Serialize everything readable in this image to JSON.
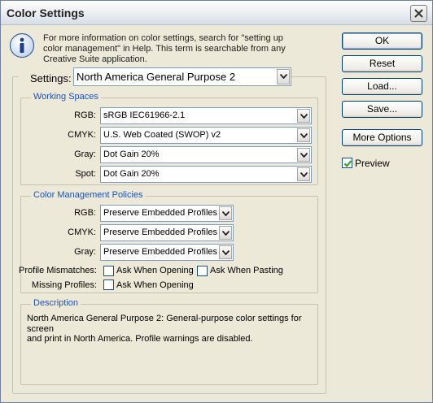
{
  "window": {
    "title": "Color Settings"
  },
  "info": {
    "line1": "For more information on color settings, search for \"setting up",
    "line2": "color management\" in Help. This term is searchable from any",
    "line3": "Creative Suite application."
  },
  "settings": {
    "label": "Settings:",
    "value": "North America General Purpose 2"
  },
  "working_spaces": {
    "title": "Working Spaces",
    "rgb_label": "RGB:",
    "rgb_value": "sRGB IEC61966-2.1",
    "cmyk_label": "CMYK:",
    "cmyk_value": "U.S. Web Coated (SWOP) v2",
    "gray_label": "Gray:",
    "gray_value": "Dot Gain 20%",
    "spot_label": "Spot:",
    "spot_value": "Dot Gain 20%"
  },
  "policies": {
    "title": "Color Management Policies",
    "rgb_label": "RGB:",
    "rgb_value": "Preserve Embedded Profiles",
    "cmyk_label": "CMYK:",
    "cmyk_value": "Preserve Embedded Profiles",
    "gray_label": "Gray:",
    "gray_value": "Preserve Embedded Profiles",
    "mismatch_label": "Profile Mismatches:",
    "ask_opening": "Ask When Opening",
    "ask_pasting": "Ask When Pasting",
    "missing_label": "Missing Profiles:",
    "missing_ask_opening": "Ask When Opening"
  },
  "description": {
    "title": "Description",
    "line1": "North America General Purpose 2:  General-purpose color settings for screen",
    "line2": "and print in North America. Profile warnings are disabled."
  },
  "buttons": {
    "ok": "OK",
    "reset": "Reset",
    "load": "Load...",
    "save": "Save...",
    "more_options": "More Options"
  },
  "preview": {
    "label": "Preview",
    "checked": true
  }
}
